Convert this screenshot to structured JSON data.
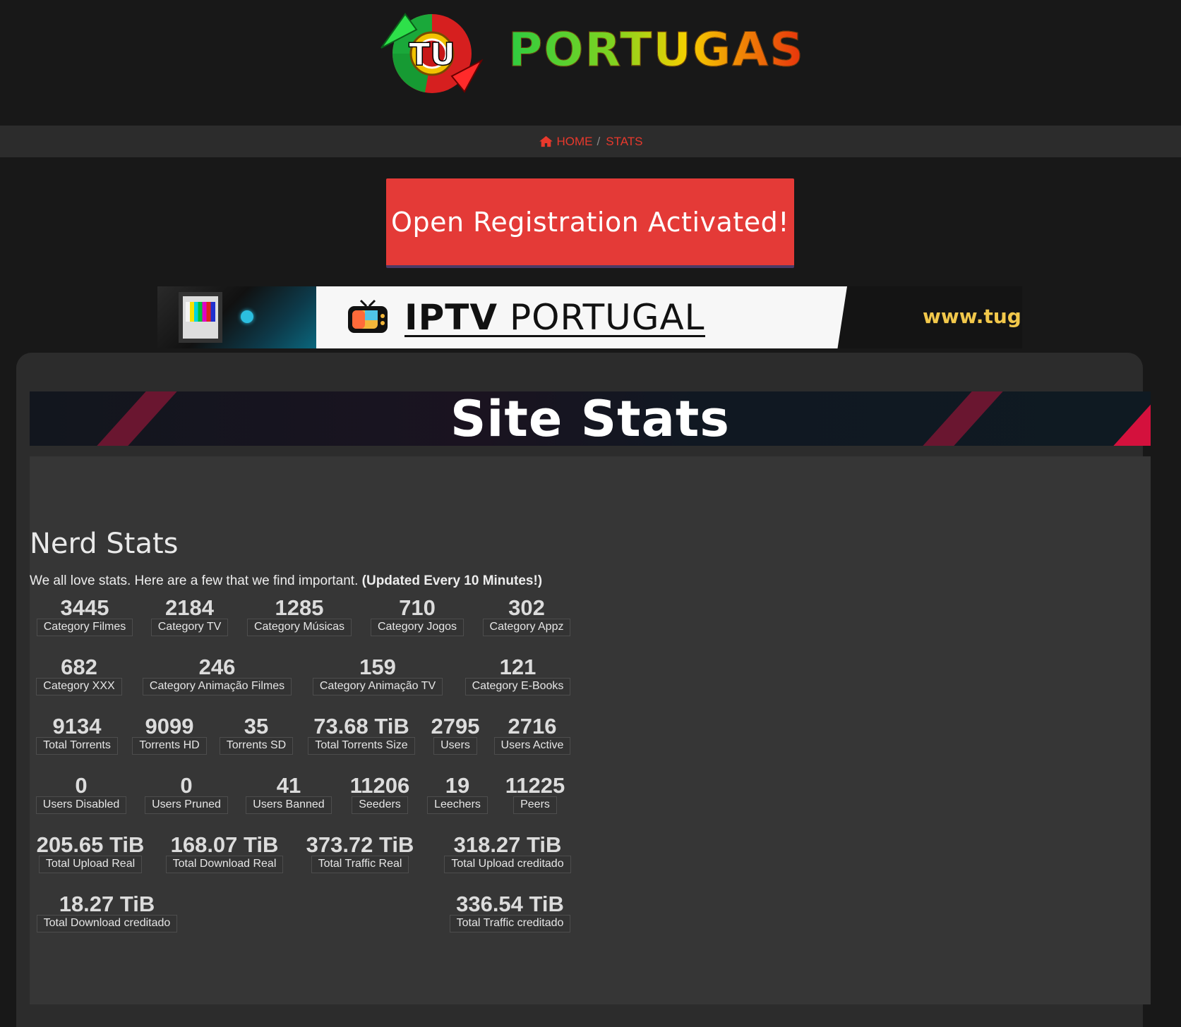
{
  "header": {
    "logo_emblem_text": "TU",
    "logo_text": "PORTUGAS"
  },
  "breadcrumb": {
    "home_label": "HOME",
    "separator": "/",
    "current_label": "STATS"
  },
  "banner": {
    "registration_label": "Open Registration Activated!"
  },
  "ad": {
    "title_bold": "IPTV",
    "title_rest": " PORTUGAL",
    "url": "www.tugaiptv.com"
  },
  "page": {
    "title": "Site Stats",
    "section_title": "Nerd Stats",
    "intro_text": "We all love stats. Here are a few that we find important. ",
    "intro_bold": "(Updated Every 10 Minutes!)"
  },
  "stats": [
    {
      "value": "3445",
      "label": "Category Filmes"
    },
    {
      "value": "2184",
      "label": "Category TV"
    },
    {
      "value": "1285",
      "label": "Category Músicas"
    },
    {
      "value": "710",
      "label": "Category Jogos"
    },
    {
      "value": "302",
      "label": "Category Appz"
    },
    {
      "value": "682",
      "label": "Category XXX"
    },
    {
      "value": "246",
      "label": "Category Animação Filmes"
    },
    {
      "value": "159",
      "label": "Category Animação TV"
    },
    {
      "value": "121",
      "label": "Category E-Books"
    },
    {
      "value": "9134",
      "label": "Total Torrents"
    },
    {
      "value": "9099",
      "label": "Torrents HD"
    },
    {
      "value": "35",
      "label": "Torrents SD"
    },
    {
      "value": "73.68 TiB",
      "label": "Total Torrents Size"
    },
    {
      "value": "2795",
      "label": "Users"
    },
    {
      "value": "2716",
      "label": "Users Active"
    },
    {
      "value": "0",
      "label": "Users Disabled"
    },
    {
      "value": "0",
      "label": "Users Pruned"
    },
    {
      "value": "41",
      "label": "Users Banned"
    },
    {
      "value": "11206",
      "label": "Seeders"
    },
    {
      "value": "19",
      "label": "Leechers"
    },
    {
      "value": "11225",
      "label": "Peers"
    },
    {
      "value": "205.65 TiB",
      "label": "Total Upload Real"
    },
    {
      "value": "168.07 TiB",
      "label": "Total Download Real"
    },
    {
      "value": "373.72 TiB",
      "label": "Total Traffic Real"
    },
    {
      "value": "318.27 TiB",
      "label": "Total Upload creditado"
    },
    {
      "value": "18.27 TiB",
      "label": "Total Download creditado"
    },
    {
      "value": "336.54 TiB",
      "label": "Total Traffic creditado"
    }
  ],
  "colors": {
    "accent": "#e43a37",
    "background": "#181818",
    "panel": "#2c2c2c",
    "content": "#363636"
  }
}
